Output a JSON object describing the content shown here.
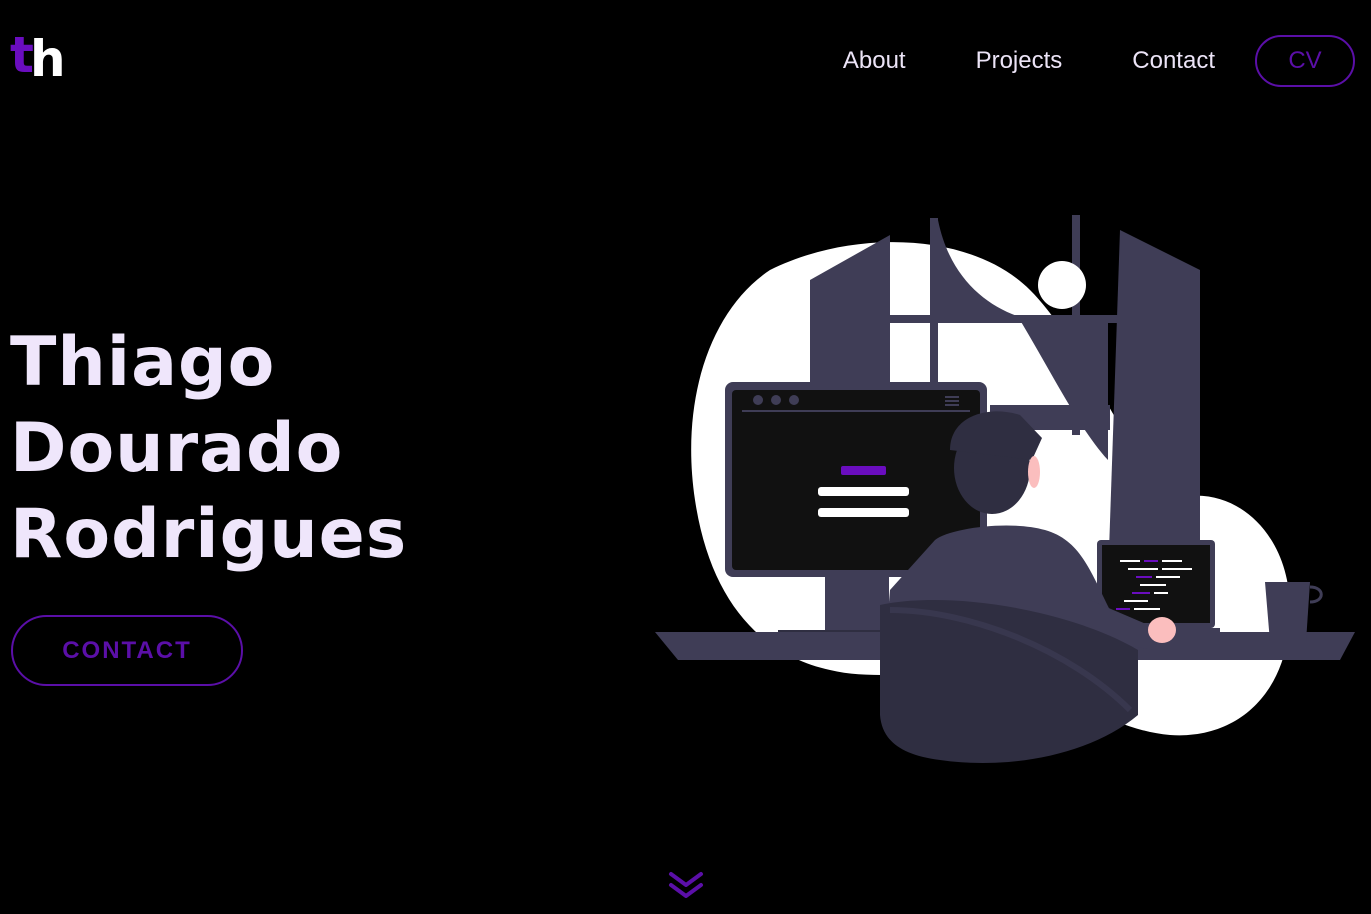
{
  "logo": {
    "t": "t",
    "h": "h"
  },
  "nav": {
    "items": [
      {
        "label": "About"
      },
      {
        "label": "Projects"
      },
      {
        "label": "Contact"
      }
    ],
    "cv_label": "CV"
  },
  "hero": {
    "name_lines": [
      "Thiago",
      "Dourado",
      "Rodrigues"
    ],
    "contact_label": "CONTACT"
  },
  "icons": {
    "scroll": "double-chevron-down-icon",
    "illustration": "developer-at-desk-illustration"
  },
  "colors": {
    "background": "#000000",
    "accent": "#5b0fa8",
    "text": "#ece4f7",
    "illustration_dark": "#3f3d56",
    "illustration_light": "#ffffff"
  }
}
